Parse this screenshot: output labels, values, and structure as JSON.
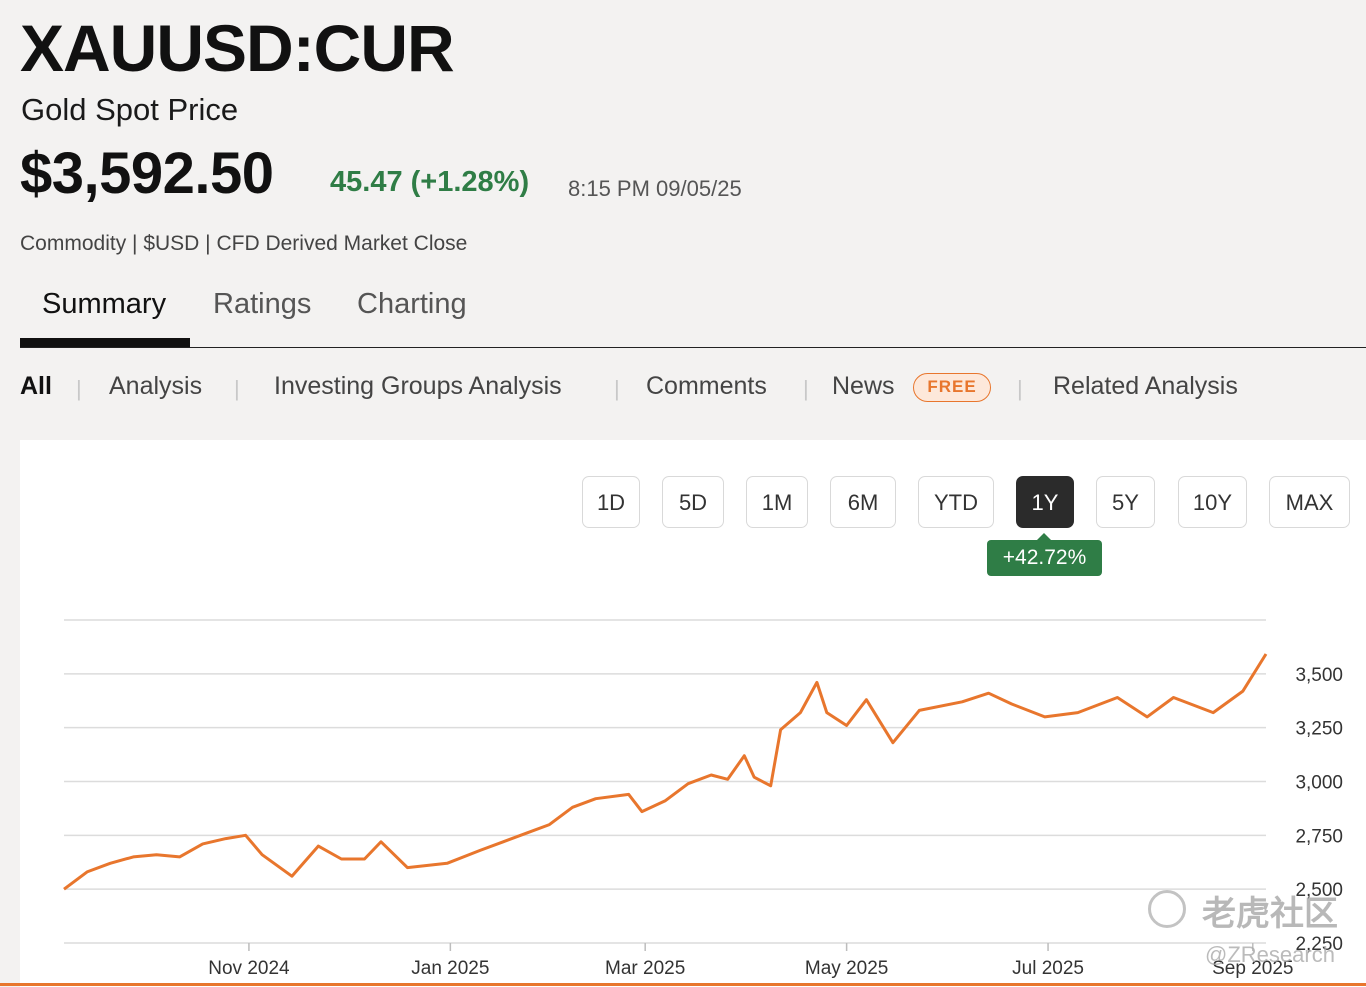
{
  "header": {
    "ticker": "XAUUSD:CUR",
    "name": "Gold Spot Price",
    "price": "$3,592.50",
    "change": "45.47 (+1.28%)",
    "timestamp": "8:15 PM 09/05/25",
    "meta": "Commodity | $USD | CFD Derived Market Close"
  },
  "tabs": [
    "Summary",
    "Ratings",
    "Charting"
  ],
  "subnav": {
    "all": "All",
    "analysis": "Analysis",
    "investing_groups": "Investing Groups Analysis",
    "comments": "Comments",
    "news": "News",
    "free_badge": "FREE",
    "related": "Related Analysis",
    "separator": "|"
  },
  "ranges": [
    "1D",
    "5D",
    "1M",
    "6M",
    "YTD",
    "1Y",
    "5Y",
    "10Y",
    "MAX"
  ],
  "active_range": "1Y",
  "performance": "+42.72%",
  "watermark": {
    "text": "老虎社区",
    "sub": "@ZResearch"
  },
  "colors": {
    "line": "#e8762d",
    "positive": "#2f7d46",
    "badge": "#e8762d"
  },
  "chart_data": {
    "type": "line",
    "x_tick_labels": [
      "Nov 2024",
      "Jan 2025",
      "Mar 2025",
      "May 2025",
      "Jul 2025",
      "Sep 2025"
    ],
    "y_tick_labels": [
      "3,500",
      "3,250",
      "3,000",
      "2,750",
      "2,500",
      "2,250"
    ],
    "ylim": [
      2250,
      3750
    ],
    "grid": true,
    "series": [
      {
        "x": [
          "2024-09-06",
          "2024-09-13",
          "2024-09-20",
          "2024-09-27",
          "2024-10-04",
          "2024-10-11",
          "2024-10-18",
          "2024-10-25",
          "2024-10-31",
          "2024-11-05",
          "2024-11-14",
          "2024-11-22",
          "2024-11-29",
          "2024-12-06",
          "2024-12-11",
          "2024-12-19",
          "2024-12-31",
          "2025-01-10",
          "2025-01-17",
          "2025-01-24",
          "2025-01-31",
          "2025-02-07",
          "2025-02-14",
          "2025-02-24",
          "2025-02-28",
          "2025-03-07",
          "2025-03-14",
          "2025-03-21",
          "2025-03-26",
          "2025-03-31",
          "2025-04-03",
          "2025-04-08",
          "2025-04-11",
          "2025-04-17",
          "2025-04-22",
          "2025-04-25",
          "2025-05-01",
          "2025-05-07",
          "2025-05-15",
          "2025-05-23",
          "2025-06-05",
          "2025-06-13",
          "2025-06-20",
          "2025-06-30",
          "2025-07-10",
          "2025-07-22",
          "2025-07-31",
          "2025-08-08",
          "2025-08-20",
          "2025-08-29",
          "2025-09-05"
        ],
        "values": [
          2500,
          2580,
          2620,
          2650,
          2660,
          2650,
          2710,
          2735,
          2750,
          2660,
          2560,
          2700,
          2640,
          2640,
          2720,
          2600,
          2620,
          2680,
          2720,
          2760,
          2800,
          2880,
          2920,
          2940,
          2860,
          2910,
          2990,
          3030,
          3010,
          3120,
          3020,
          2980,
          3240,
          3320,
          3460,
          3320,
          3260,
          3380,
          3180,
          3330,
          3370,
          3410,
          3360,
          3300,
          3320,
          3390,
          3300,
          3390,
          3320,
          3420,
          3592
        ]
      }
    ]
  }
}
